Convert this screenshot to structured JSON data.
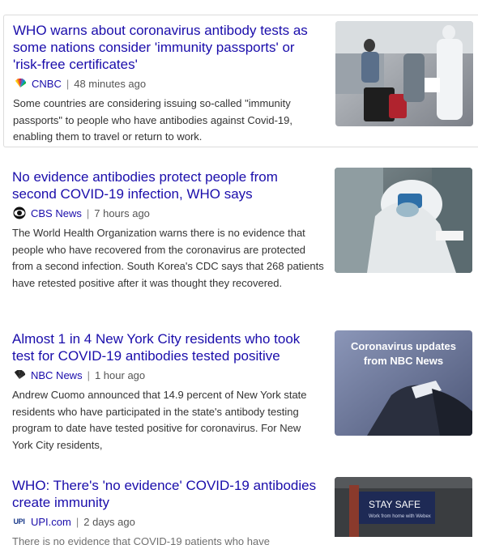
{
  "articles": [
    {
      "headline": "WHO warns about coronavirus antibody tests as some nations consider 'immunity passports' or 'risk-free certificates'",
      "source": "CNBC",
      "time": "48 minutes ago",
      "snippet": "Some countries are considering issuing so-called \"immunity passports\" to people who have antibodies against Covid-19, enabling them to travel or return to work.",
      "logo_icon": "cnbc-peacock-icon"
    },
    {
      "headline": "No evidence antibodies protect people from second COVID-19 infection, WHO says",
      "source": "CBS News",
      "time": "7 hours ago",
      "snippet": "The World Health Organization warns there is no evidence that people who have recovered from the coronavirus are protected from a second infection. South Korea's CDC says that 268 patients have retested positive after it was thought they recovered.",
      "logo_icon": "cbs-eye-icon"
    },
    {
      "headline": "Almost 1 in 4 New York City residents who took test for COVID-19 antibodies tested positive",
      "source": "NBC News",
      "time": "1 hour ago",
      "snippet": "Andrew Cuomo announced that 14.9 percent of New York state residents who have participated in the state's antibody testing program to date have tested positive for coronavirus. For New York City residents,",
      "logo_icon": "nbc-peacock-icon",
      "thumb_caption": "Coronavirus updates from NBC News"
    },
    {
      "headline": "WHO: There's 'no evidence' COVID-19 antibodies create immunity",
      "source": "UPI.com",
      "time": "2 days ago",
      "snippet": "There is no evidence that COVID-19 patients who have",
      "logo_icon": "upi-logo-icon",
      "logo_text": "UPI",
      "thumb_caption": "STAY SAFE",
      "thumb_subcaption": "Work from home with Webex"
    }
  ],
  "separator": "|",
  "colors": {
    "link": "#1a0dab",
    "meta": "#555555",
    "card_border": "#dcdcdc"
  }
}
